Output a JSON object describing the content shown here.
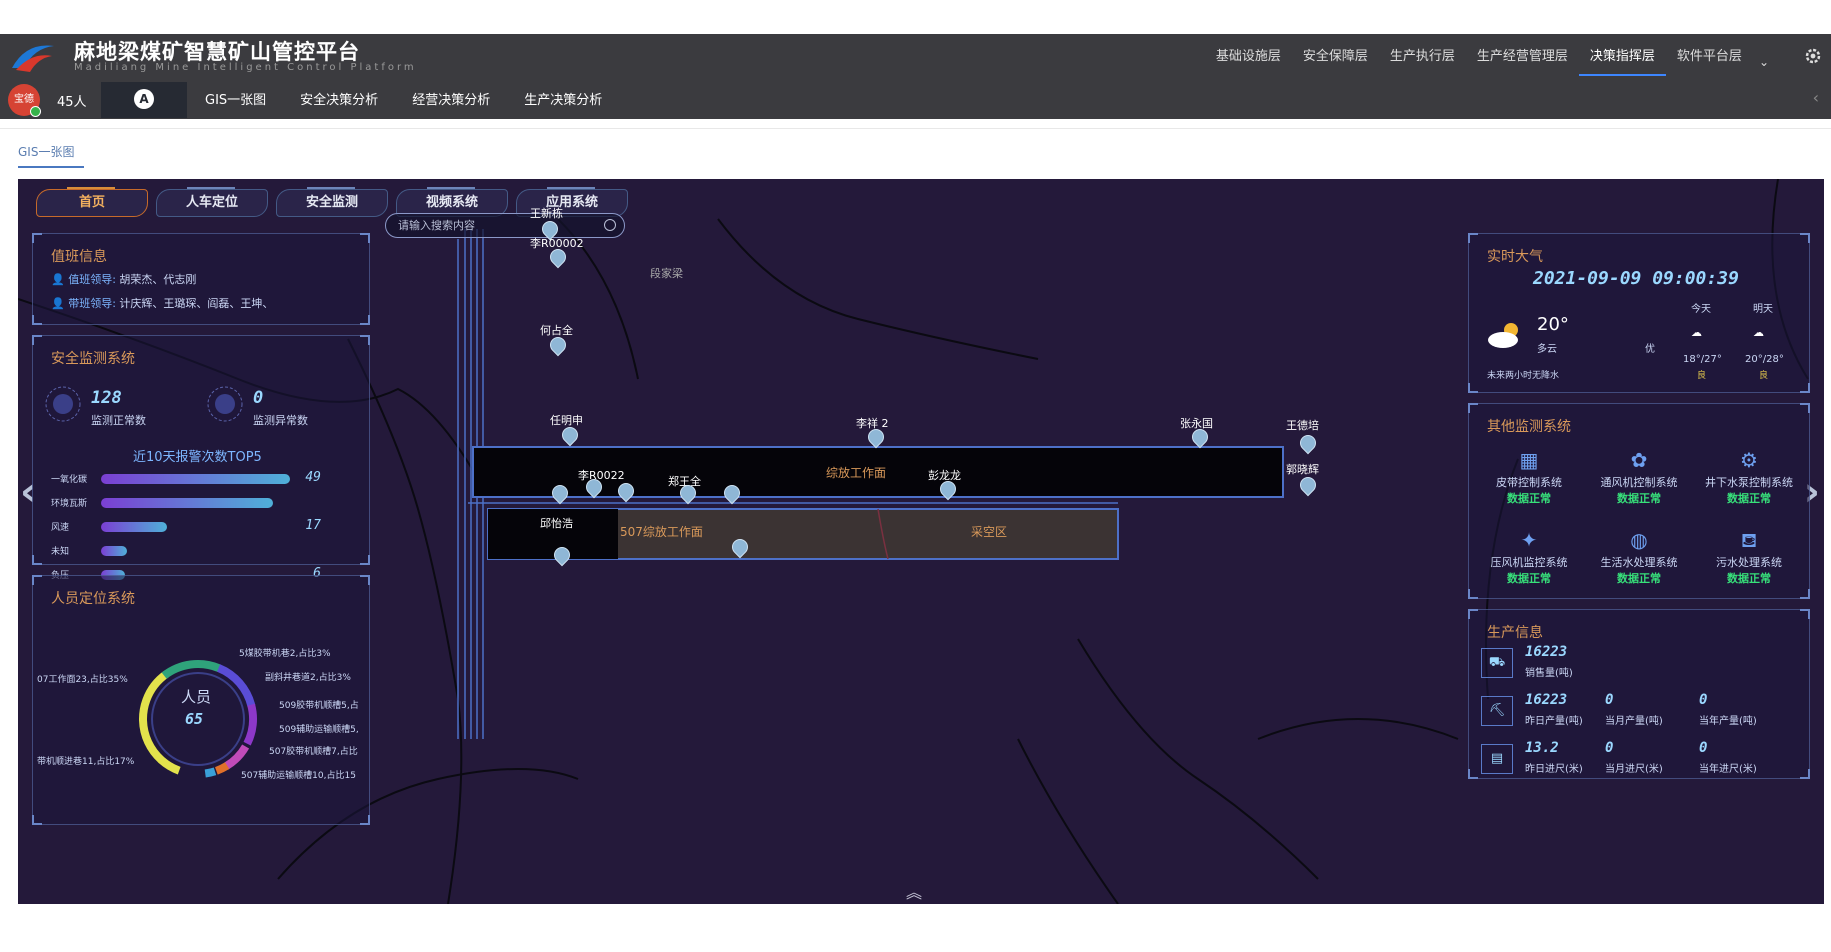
{
  "header": {
    "title": "麻地梁煤矿智慧矿山管控平台",
    "subtitle": "Madiliang Mine Intelligent Control Platform",
    "layers": [
      "基础设施层",
      "安全保障层",
      "生产执行层",
      "生产经营管理层",
      "决策指挥层",
      "软件平台层"
    ],
    "active_layer": "决策指挥层"
  },
  "subheader": {
    "avatar_text": "宝德",
    "people_count": "45人",
    "badge": "A",
    "tabs": [
      "GIS一张图",
      "安全决策分析",
      "经营决策分析",
      "生产决策分析"
    ]
  },
  "page_tab": "GIS一张图",
  "map_nav": [
    "首页",
    "人车定位",
    "安全监测",
    "视频系统",
    "应用系统"
  ],
  "duty": {
    "title": "值班信息",
    "leader_label": "值班领导:",
    "leader_names": "胡荣杰、代志刚",
    "shift_label": "带班领导:",
    "shift_names": "计庆辉、王璐琛、阎磊、王坤、"
  },
  "safety": {
    "title": "安全监测系统",
    "normal_count": "128",
    "normal_label": "监测正常数",
    "abnormal_count": "0",
    "abnormal_label": "监测异常数",
    "top5_title": "近10天报警次数TOP5",
    "bars": [
      {
        "name": "一氧化碳",
        "value": "49",
        "ratio": 0.86
      },
      {
        "name": "环境瓦斯",
        "value": "",
        "ratio": 0.78
      },
      {
        "name": "风速",
        "value": "17",
        "ratio": 0.3
      },
      {
        "name": "未知",
        "value": "",
        "ratio": 0.12
      },
      {
        "name": "负压",
        "value": "6",
        "ratio": 0.11
      }
    ]
  },
  "personnel": {
    "title": "人员定位系统",
    "center_label": "人员",
    "center_value": "65",
    "items": [
      "5煤胶带机巷2,占比3%",
      "副斜井巷道2,占比3%",
      "509胶带机顺槽5,占",
      "509辅助运输顺槽5,",
      "507胶带机顺槽7,占比",
      "507辅助运输顺槽10,占比15",
      "带机顺进巷11,占比17%",
      "07工作面23,占比35%"
    ]
  },
  "weather": {
    "title": "实时大气",
    "datetime": "2021-09-09 09:00:39",
    "temp": "20°",
    "desc": "多云",
    "aqi": "优",
    "today_label": "今天",
    "tomorrow_label": "明天",
    "today_range": "18°/27°",
    "today_quality": "良",
    "tomorrow_range": "20°/28°",
    "tomorrow_quality": "良",
    "rain_note": "未来两小时无降水"
  },
  "other_systems": {
    "title": "其他监测系统",
    "items": [
      {
        "name": "皮带控制系统",
        "status": "数据正常"
      },
      {
        "name": "通风机控制系统",
        "status": "数据正常"
      },
      {
        "name": "井下水泵控制系统",
        "status": "数据正常"
      },
      {
        "name": "压风机监控系统",
        "status": "数据正常"
      },
      {
        "name": "生活水处理系统",
        "status": "数据正常"
      },
      {
        "name": "污水处理系统",
        "status": "数据正常"
      }
    ]
  },
  "production": {
    "title": "生产信息",
    "sales_value": "16223",
    "sales_label": "销售量(吨)",
    "yday_out_value": "16223",
    "yday_out_label": "昨日产量(吨)",
    "month_out_value": "0",
    "month_out_label": "当月产量(吨)",
    "year_out_value": "0",
    "year_out_label": "当年产量(吨)",
    "yday_adv_value": "13.2",
    "yday_adv_label": "昨日进尺(米)",
    "month_adv_value": "0",
    "month_adv_label": "当月进尺(米)",
    "year_adv_value": "0",
    "year_adv_label": "当年进尺(米)"
  },
  "map": {
    "search_placeholder": "请输入搜索内容",
    "place_name": "段家梁",
    "face_label_1": "综放工作面",
    "face_label_2": "507综放工作面",
    "goaf_label": "采空区",
    "person_labels": [
      "王新栋",
      "李R00002",
      "何占全",
      "任明申",
      "李祥 2",
      "张永国",
      "王德培",
      "郭晓辉",
      "彭龙龙",
      "邱怡浩",
      "郑王全",
      "李R0022"
    ]
  }
}
